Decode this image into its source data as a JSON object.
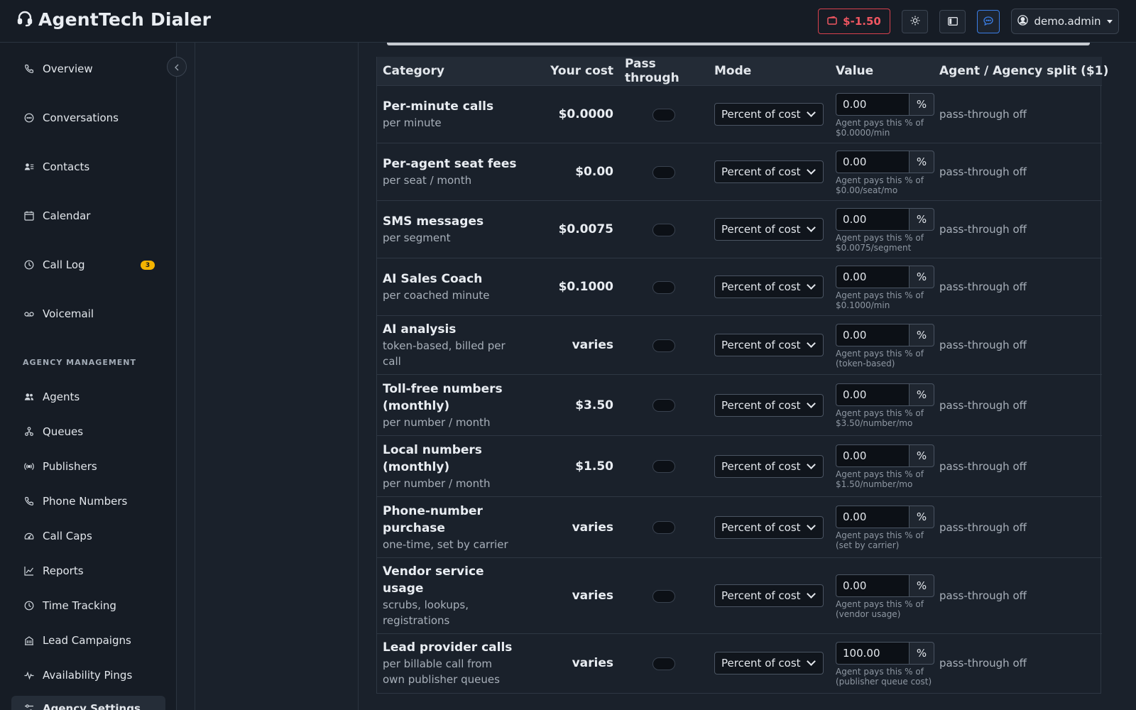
{
  "header": {
    "app_title": "AgentTech Dialer",
    "balance": "$-1.50",
    "user": "demo.admin"
  },
  "sidebar": {
    "items": [
      {
        "label": "Overview",
        "icon": "phone-icon"
      },
      {
        "label": "Conversations",
        "icon": "chat-icon"
      },
      {
        "label": "Contacts",
        "icon": "contacts-icon"
      },
      {
        "label": "Calendar",
        "icon": "calendar-icon"
      },
      {
        "label": "Call Log",
        "icon": "clock-icon",
        "badge": "3"
      },
      {
        "label": "Voicemail",
        "icon": "voicemail-icon"
      }
    ],
    "section_label": "AGENCY MANAGEMENT",
    "agency_items": [
      {
        "label": "Agents",
        "icon": "users-icon"
      },
      {
        "label": "Queues",
        "icon": "queue-icon"
      },
      {
        "label": "Publishers",
        "icon": "broadcast-icon"
      },
      {
        "label": "Phone Numbers",
        "icon": "phone-icon"
      },
      {
        "label": "Call Caps",
        "icon": "gauge-icon"
      },
      {
        "label": "Reports",
        "icon": "chart-line-icon"
      },
      {
        "label": "Time Tracking",
        "icon": "clock-icon"
      },
      {
        "label": "Lead Campaigns",
        "icon": "building-icon"
      },
      {
        "label": "Availability Pings",
        "icon": "pulse-icon"
      },
      {
        "label": "Agency Settings",
        "icon": "sliders-icon"
      }
    ]
  },
  "table": {
    "headers": {
      "category": "Category",
      "cost": "Your cost",
      "pass": "Pass through",
      "mode": "Mode",
      "value": "Value",
      "split": "Agent / Agency split ($1)"
    },
    "rows": [
      {
        "name": "Per-minute calls",
        "sub": "per minute",
        "cost": "$0.0000",
        "mode": "Percent of cost",
        "value": "0.00",
        "unit": "%",
        "help": "Agent pays this % of $0.0000/min",
        "split": "pass-through off"
      },
      {
        "name": "Per-agent seat fees",
        "sub": "per seat / month",
        "cost": "$0.00",
        "mode": "Percent of cost",
        "value": "0.00",
        "unit": "%",
        "help": "Agent pays this % of $0.00/seat/mo",
        "split": "pass-through off"
      },
      {
        "name": "SMS messages",
        "sub": "per segment",
        "cost": "$0.0075",
        "mode": "Percent of cost",
        "value": "0.00",
        "unit": "%",
        "help": "Agent pays this % of $0.0075/segment",
        "split": "pass-through off"
      },
      {
        "name": "AI Sales Coach",
        "sub": "per coached minute",
        "cost": "$0.1000",
        "mode": "Percent of cost",
        "value": "0.00",
        "unit": "%",
        "help": "Agent pays this % of $0.1000/min",
        "split": "pass-through off"
      },
      {
        "name": "AI analysis",
        "sub": "token-based, billed per call",
        "cost": "varies",
        "mode": "Percent of cost",
        "value": "0.00",
        "unit": "%",
        "help": "Agent pays this % of (token-based)",
        "split": "pass-through off"
      },
      {
        "name": "Toll-free numbers (monthly)",
        "sub": "per number / month",
        "cost": "$3.50",
        "mode": "Percent of cost",
        "value": "0.00",
        "unit": "%",
        "help": "Agent pays this % of $3.50/number/mo",
        "split": "pass-through off"
      },
      {
        "name": "Local numbers (monthly)",
        "sub": "per number / month",
        "cost": "$1.50",
        "mode": "Percent of cost",
        "value": "0.00",
        "unit": "%",
        "help": "Agent pays this % of $1.50/number/mo",
        "split": "pass-through off"
      },
      {
        "name": "Phone-number purchase",
        "sub": "one-time, set by carrier",
        "cost": "varies",
        "mode": "Percent of cost",
        "value": "0.00",
        "unit": "%",
        "help": "Agent pays this % of (set by carrier)",
        "split": "pass-through off"
      },
      {
        "name": "Vendor service usage",
        "sub": "scrubs, lookups, registrations",
        "cost": "varies",
        "mode": "Percent of cost",
        "value": "0.00",
        "unit": "%",
        "help": "Agent pays this % of (vendor usage)",
        "split": "pass-through off"
      },
      {
        "name": "Lead provider calls",
        "sub": "per billable call from own publisher queues",
        "cost": "varies",
        "mode": "Percent of cost",
        "value": "100.00",
        "unit": "%",
        "help": "Agent pays this % of (publisher queue cost)",
        "split": "pass-through off"
      }
    ]
  },
  "colors": {
    "accent": "#3a7ee6",
    "danger": "#ef5661",
    "badge": "#f4b400"
  }
}
